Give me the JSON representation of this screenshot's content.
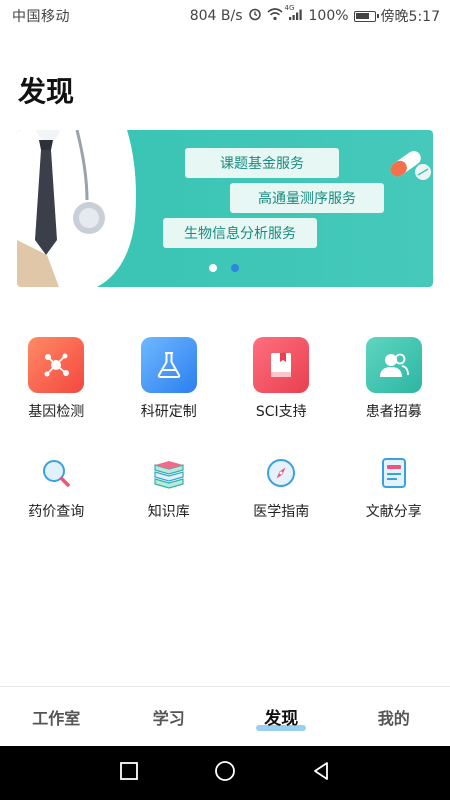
{
  "status_bar": {
    "carrier": "中国移动",
    "speed": "804 B/s",
    "network": "4G",
    "battery": "100%",
    "time": "傍晚5:17"
  },
  "page": {
    "title": "发现"
  },
  "banner": {
    "tags": [
      "课题基金服务",
      "高通量测序服务",
      "生物信息分析服务"
    ],
    "slide_count": 2,
    "active_slide": 2
  },
  "features_main": [
    {
      "label": "基因检测",
      "icon": "gene-network-icon",
      "color": "#f4473f"
    },
    {
      "label": "科研定制",
      "icon": "flask-icon",
      "color": "#2b7ff0"
    },
    {
      "label": "SCI支持",
      "icon": "book-icon",
      "color": "#e8404f"
    },
    {
      "label": "患者招募",
      "icon": "people-icon",
      "color": "#2cb6a3"
    }
  ],
  "features_secondary": [
    {
      "label": "药价查询",
      "icon": "magnifier-icon"
    },
    {
      "label": "知识库",
      "icon": "book-stack-icon"
    },
    {
      "label": "医学指南",
      "icon": "compass-icon"
    },
    {
      "label": "文献分享",
      "icon": "document-icon"
    }
  ],
  "bottom_nav": {
    "items": [
      "工作室",
      "学习",
      "发现",
      "我的"
    ],
    "active": "发现",
    "accent": "#7ec4ee"
  }
}
